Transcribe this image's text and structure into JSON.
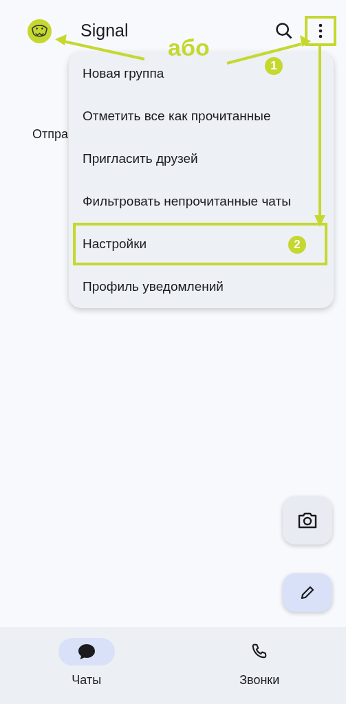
{
  "app_bar": {
    "title": "Signal"
  },
  "background_text": "Отпра",
  "menu": {
    "items": [
      {
        "label": "Новая группа",
        "highlighted": false
      },
      {
        "label": "Отметить все как прочитанные",
        "highlighted": false
      },
      {
        "label": "Пригласить друзей",
        "highlighted": false
      },
      {
        "label": "Фильтровать непрочитанные чаты",
        "highlighted": false
      },
      {
        "label": "Настройки",
        "highlighted": true
      },
      {
        "label": "Профиль уведомлений",
        "highlighted": false
      }
    ]
  },
  "annotations": {
    "or_label": "або",
    "steps": [
      "1",
      "2"
    ]
  },
  "bottom_nav": [
    {
      "label": "Чаты",
      "selected": true,
      "kind": "chat"
    },
    {
      "label": "Звонки",
      "selected": false,
      "kind": "phone"
    }
  ]
}
